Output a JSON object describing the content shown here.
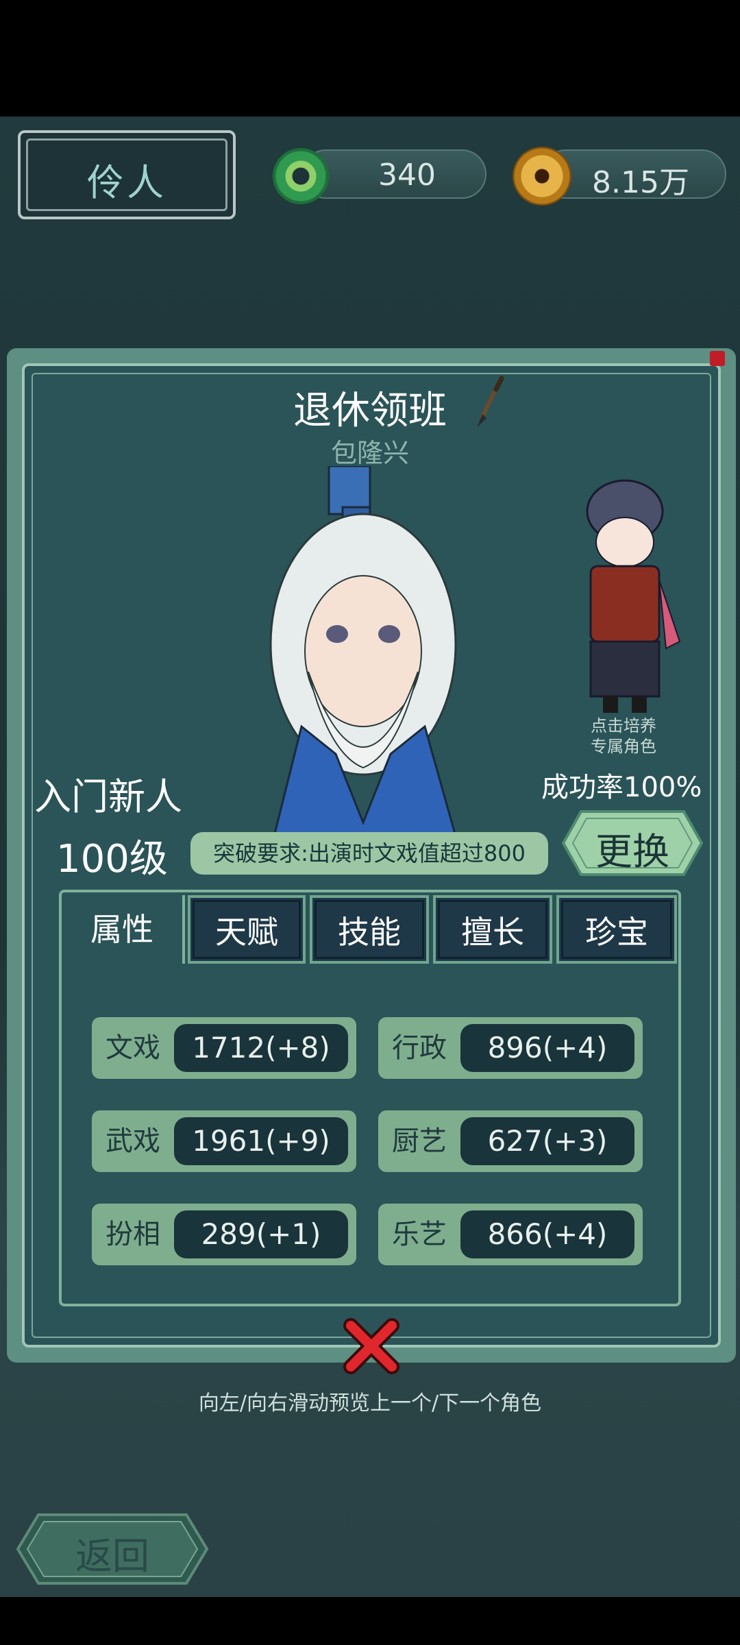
{
  "header": {
    "title": "伶人",
    "jade_amount": "340",
    "coin_amount": "8.15万"
  },
  "character": {
    "title": "退休领班",
    "name": "包隆兴",
    "rank": "入门新人",
    "level": "100级",
    "breakthrough": "突破要求:出演时文戏值超过800",
    "train_label_1": "点击培养",
    "train_label_2": "专属角色",
    "success_rate": "成功率100%",
    "change_label": "更换"
  },
  "tabs": [
    {
      "label": "属性",
      "active": true
    },
    {
      "label": "天赋",
      "active": false
    },
    {
      "label": "技能",
      "active": false
    },
    {
      "label": "擅长",
      "active": false
    },
    {
      "label": "珍宝",
      "active": false
    }
  ],
  "stats": [
    {
      "label": "文戏",
      "value": "1712(+8)"
    },
    {
      "label": "行政",
      "value": "896(+4)"
    },
    {
      "label": "武戏",
      "value": "1961(+9)"
    },
    {
      "label": "厨艺",
      "value": "627(+3)"
    },
    {
      "label": "扮相",
      "value": "289(+1)"
    },
    {
      "label": "乐艺",
      "value": "866(+4)"
    }
  ],
  "hint": "向左/向右滑动预览上一个/下一个角色",
  "back_label": "返回",
  "icons": {
    "jade": "jade-disc-icon",
    "coin": "copper-coin-icon",
    "brush": "brush-icon",
    "close": "close-icon"
  }
}
